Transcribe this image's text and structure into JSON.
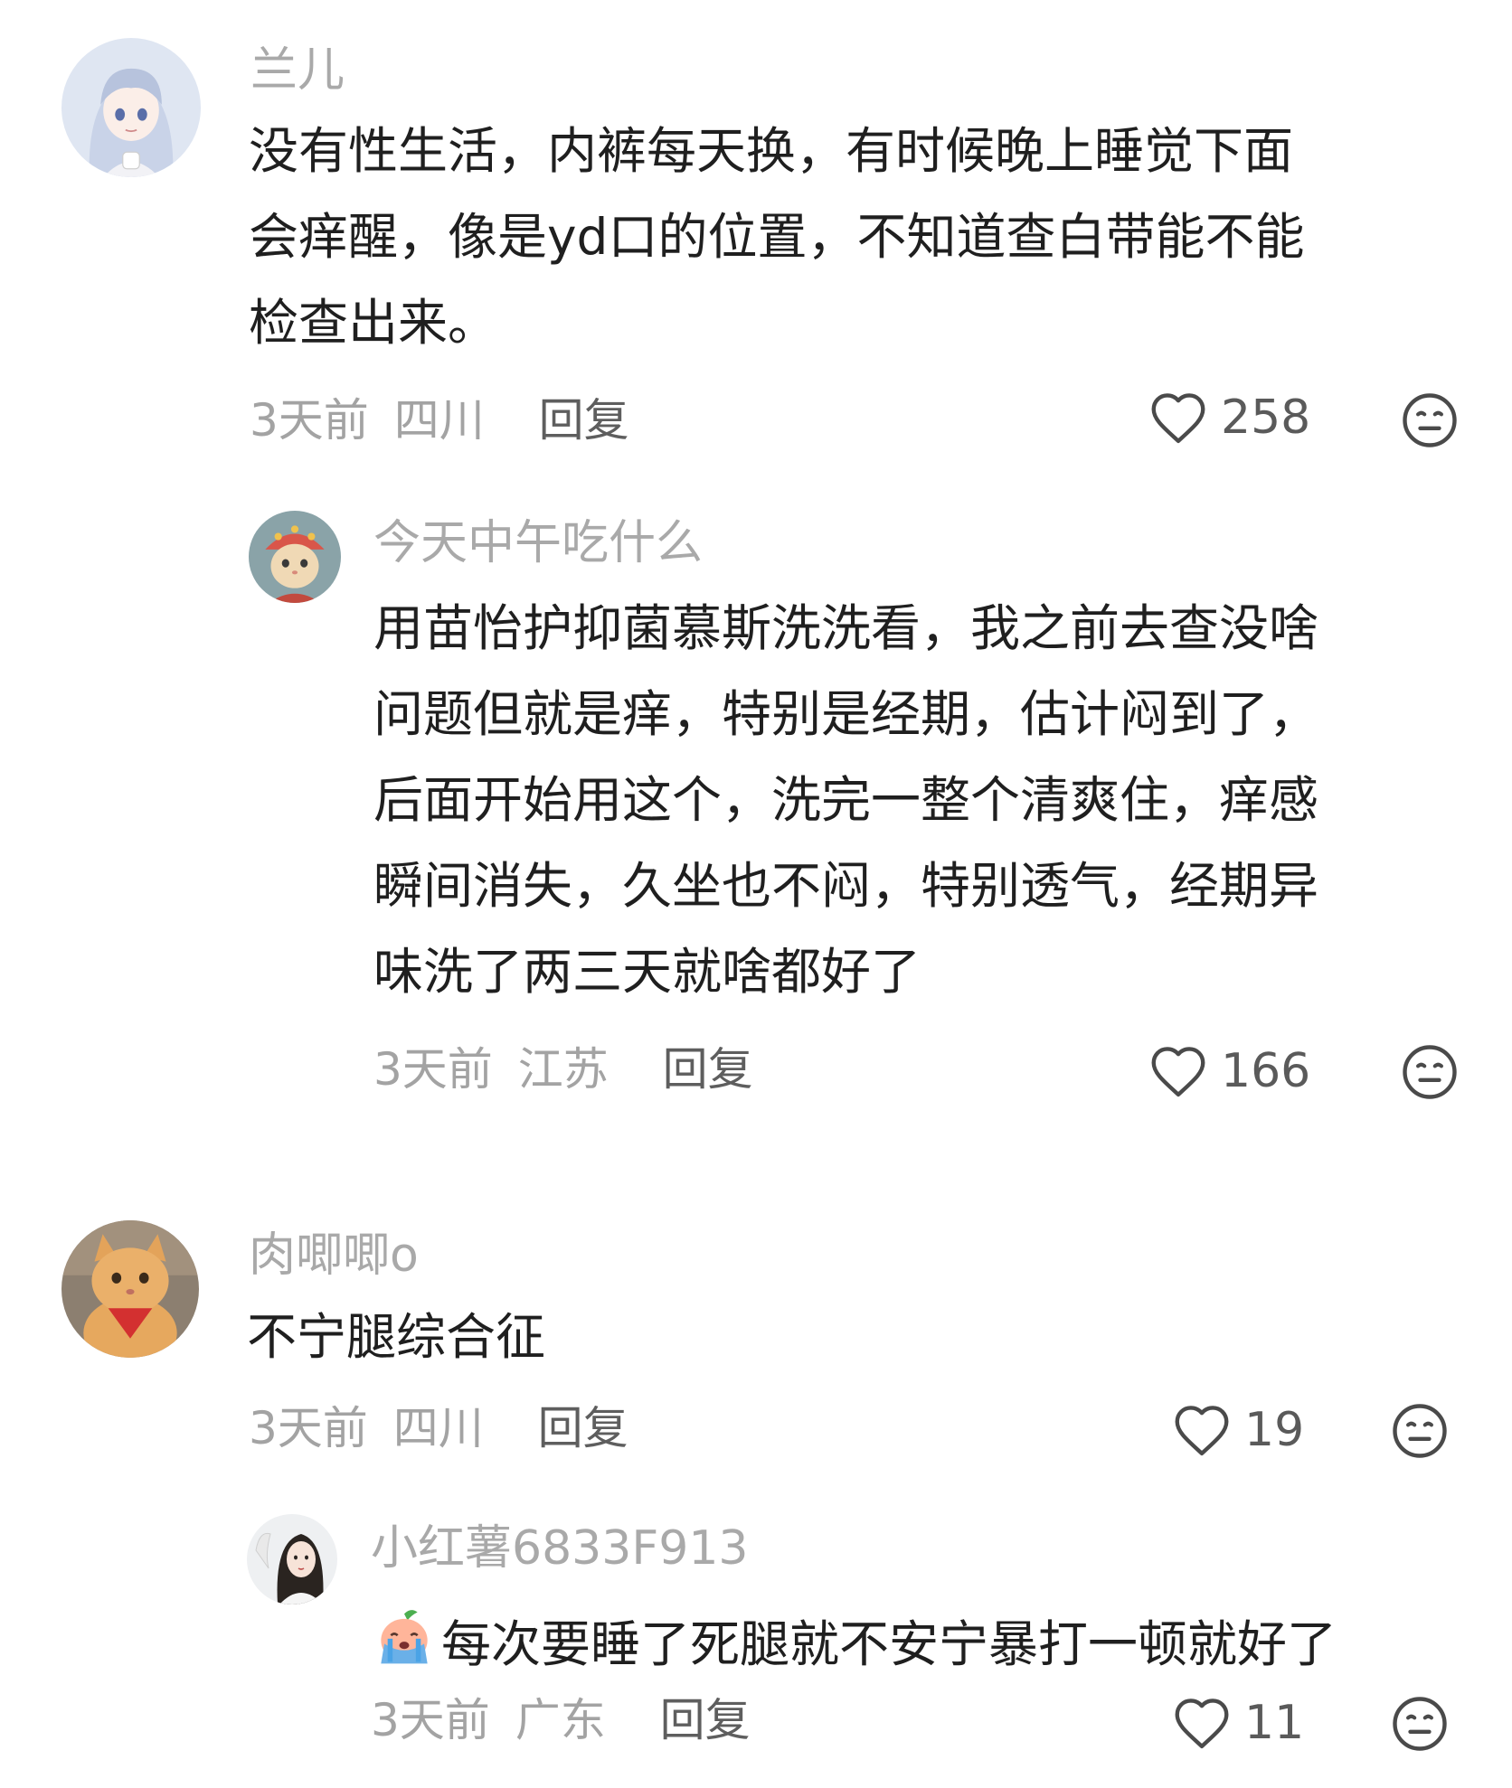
{
  "comments": [
    {
      "user": "兰儿",
      "lines": [
        "没有性生活，内裤每天换，有时候晚上睡觉下面",
        "会痒醒，像是yd口的位置，不知道查白带能不能",
        "检查出来。"
      ],
      "time": "3天前",
      "location": "四川",
      "reply": "回复",
      "likes": "258",
      "avatar_icon": "anime-girl-avatar",
      "replies": [
        {
          "user": "今天中午吃什么",
          "lines": [
            "用苗怡护抑菌慕斯洗洗看，我之前去查没啥",
            "问题但就是痒，特别是经期，估计闷到了，",
            "后面开始用这个，洗完一整个清爽住，痒感",
            "瞬间消失，久坐也不闷，特别透气，经期异",
            "味洗了两三天就啥都好了"
          ],
          "time": "3天前",
          "location": "江苏",
          "reply": "回复",
          "likes": "166",
          "avatar_icon": "cat-in-costume-avatar"
        }
      ]
    },
    {
      "user": "肉唧唧o",
      "lines": [
        "不宁腿综合征"
      ],
      "time": "3天前",
      "location": "四川",
      "reply": "回复",
      "likes": "19",
      "avatar_icon": "orange-cat-avatar",
      "replies": [
        {
          "user": "小红薯6833F913",
          "emoji": "crying-peach-emoji",
          "lines": [
            "每次要睡了死腿就不安宁暴打一顿就好了"
          ],
          "time": "3天前",
          "location": "广东",
          "reply": "回复",
          "likes": "11",
          "avatar_icon": "woman-portrait-avatar"
        }
      ]
    }
  ],
  "colors": {
    "username": "#a9a9a9",
    "text": "#1f1f1f",
    "meta": "#a3a3a3",
    "reply": "#5e5e5e",
    "icon": "#4a4a4a"
  }
}
